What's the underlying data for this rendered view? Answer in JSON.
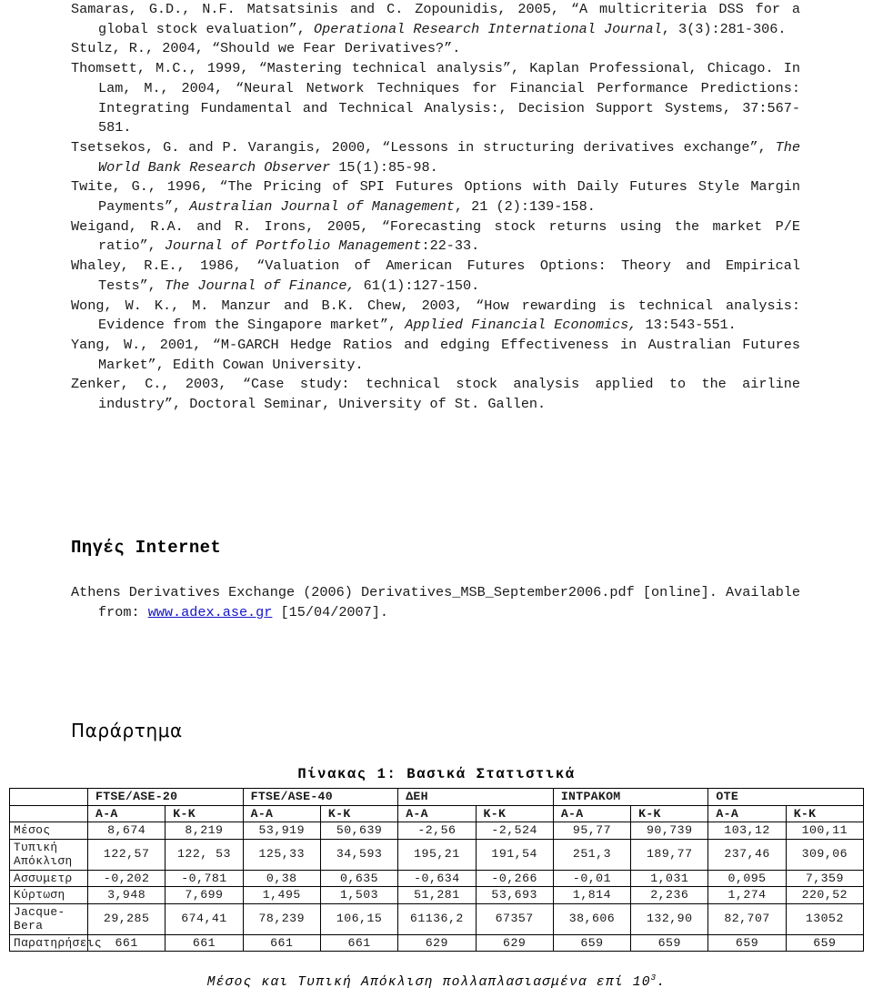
{
  "bibliography": {
    "entries": [
      {
        "parts": [
          {
            "t": "Samaras, G.D., N.F. Matsatsinis and C. Zopounidis, 2005, “A multicriteria DSS for a global stock evaluation”, ",
            "i": false
          },
          {
            "t": "Operational Research International Journal",
            "i": true
          },
          {
            "t": ", 3(3):281-306.",
            "i": false
          }
        ]
      },
      {
        "parts": [
          {
            "t": "Stulz, R., 2004, “Should we Fear Derivatives?”.",
            "i": false
          }
        ]
      },
      {
        "parts": [
          {
            "t": "Thomsett, M.C., 1999, “Mastering technical analysis”, Kaplan Professional, Chicago. In Lam, M., 2004, “Neural Network Techniques for Financial Performance Predictions: Integrating Fundamental and Technical Analysis:, Decision Support Systems, 37:567-581.",
            "i": false
          }
        ]
      },
      {
        "parts": [
          {
            "t": "Tsetsekos, G. and P. Varangis, 2000, “Lessons in structuring derivatives exchange”, ",
            "i": false
          },
          {
            "t": "The World Bank Research Observer",
            "i": true
          },
          {
            "t": " 15(1):85-98.",
            "i": false
          }
        ]
      },
      {
        "parts": [
          {
            "t": "Twite, G., 1996, “The Pricing of SPI Futures Options with Daily Futures Style Margin Payments”, ",
            "i": false
          },
          {
            "t": "Australian Journal of Management",
            "i": true
          },
          {
            "t": ", 21 (2):139-158.",
            "i": false
          }
        ]
      },
      {
        "parts": [
          {
            "t": "Weigand, R.A. and R. Irons, 2005, “Forecasting stock returns using the market P/E ratio”, ",
            "i": false
          },
          {
            "t": "Journal of Portfolio Management",
            "i": true
          },
          {
            "t": ":22-33.",
            "i": false
          }
        ]
      },
      {
        "parts": [
          {
            "t": "Whaley, R.E., 1986, “Valuation of American Futures Options: Theory and Empirical Tests”, ",
            "i": false
          },
          {
            "t": "The Journal of Finance,",
            "i": true
          },
          {
            "t": " 61(1):127-150.",
            "i": false
          }
        ]
      },
      {
        "parts": [
          {
            "t": "Wong, W. K., M. Manzur and B.K. Chew, 2003, “How rewarding is technical analysis: Evidence from the Singapore market”, ",
            "i": false
          },
          {
            "t": "Applied Financial Economics,",
            "i": true
          },
          {
            "t": " 13:543-551.",
            "i": false
          }
        ]
      },
      {
        "parts": [
          {
            "t": "Yang, W., 2001, “M-GARCH Hedge Ratios and edging Effectiveness in Australian Futures Market”, Edith Cowan University.",
            "i": false
          }
        ]
      },
      {
        "parts": [
          {
            "t": "Zenker, C., 2003, “Case study: technical stock analysis applied to the airline industry”, Doctoral Seminar, University of St. Gallen.",
            "i": false
          }
        ]
      }
    ]
  },
  "internet_sources": {
    "heading": "Πηγές Internet",
    "entry_before_link": "Athens Derivatives Exchange (2006) Derivatives_MSB_September2006.pdf [online]. Available from: ",
    "link_text": "www.adex.ase.gr",
    "entry_after_link": " [15/04/2007]."
  },
  "appendix": {
    "heading": "Παράρτημα",
    "table_title": "Πίνακας 1: Βασικά Στατιστικά",
    "note_text": "Μέσος και Τυπική Απόκλιση πολλαπλασιασμένα επί 10",
    "note_sup": "3",
    "note_end": ".",
    "table": {
      "corner": "",
      "groups": [
        "FTSE/ASE-20",
        "FTSE/ASE-40",
        "ΔΕΗ",
        "ΙΝΤΡΑΚΟΜ",
        "ΟΤΕ"
      ],
      "subheaders": [
        "A-A",
        "K-K",
        "A-A",
        "K-K",
        "A-A",
        "K-K",
        "A-A",
        "K-K",
        "A-A",
        "K-K"
      ],
      "rows": [
        {
          "label": "Μέσος",
          "values": [
            "8,674",
            "8,219",
            "53,919",
            "50,639",
            "-2,56",
            "-2,524",
            "95,77",
            "90,739",
            "103,12",
            "100,11"
          ]
        },
        {
          "label": "Τυπική Απόκλιση",
          "values": [
            "122,57",
            "122, 53",
            "125,33",
            "34,593",
            "195,21",
            "191,54",
            "251,3",
            "189,77",
            "237,46",
            "309,06"
          ]
        },
        {
          "label": "Ασσυμετρ",
          "values": [
            "-0,202",
            "-0,781",
            "0,38",
            "0,635",
            "-0,634",
            "-0,266",
            "-0,01",
            "1,031",
            "0,095",
            "7,359"
          ]
        },
        {
          "label": "Κύρτωση",
          "values": [
            "3,948",
            "7,699",
            "1,495",
            "1,503",
            "51,281",
            "53,693",
            "1,814",
            "2,236",
            "1,274",
            "220,52"
          ]
        },
        {
          "label": "Jacque-Bera",
          "values": [
            "29,285",
            "674,41",
            "78,239",
            "106,15",
            "61136,2",
            "67357",
            "38,606",
            "132,90",
            "82,707",
            "13052"
          ]
        },
        {
          "label": "Παρατηρήσεις",
          "values": [
            "661",
            "661",
            "661",
            "661",
            "629",
            "629",
            "659",
            "659",
            "659",
            "659"
          ]
        }
      ]
    }
  },
  "colors": {
    "link": "#1414c8",
    "text": "#1a1a1a",
    "border": "#000000"
  }
}
